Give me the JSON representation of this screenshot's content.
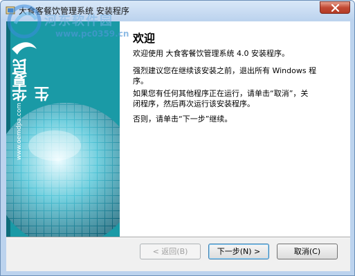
{
  "window": {
    "title": "大食客餐饮管理系统 安装程序"
  },
  "watermark": {
    "text": "河东软件园",
    "url": "www.pc0359.cn"
  },
  "banner": {
    "brand_name": "华夏民生",
    "url": "www.oemdpa.com"
  },
  "content": {
    "heading": "欢迎",
    "para1": "欢迎使用 大食客餐饮管理系统 4.0 安装程序。",
    "para2": "强烈建议您在继续该安装之前，退出所有 Windows 程\n序。",
    "para3": "如果您有任何其他程序正在运行，请单击“取消”，关\n闭程序，然后再次运行该安装程序。",
    "para4": "否则，请单击“下一步”继续。"
  },
  "buttons": {
    "back": "< 返回(B)",
    "next": "下一步(N) >",
    "cancel": "取消(C)"
  },
  "colors": {
    "banner_teal": "#1a9aa6",
    "title_bg": "#bcd3ee",
    "close_red": "#c24a34"
  }
}
